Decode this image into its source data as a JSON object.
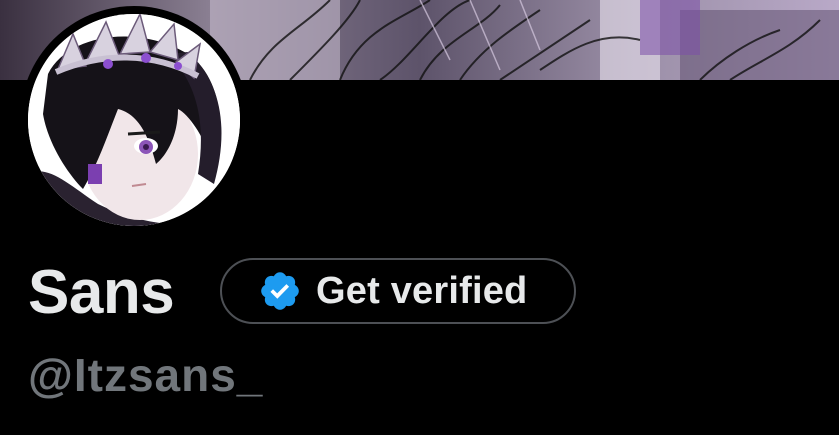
{
  "profile": {
    "display_name": "Sans",
    "handle": "@Itzsans_",
    "verify_button_label": "Get verified"
  },
  "icons": {
    "verified": "verified-badge-icon"
  },
  "colors": {
    "background": "#000000",
    "name_text": "#e7e9ea",
    "handle_text": "#71767b",
    "verified_badge": "#1d9bf0",
    "button_border": "#4d5055"
  }
}
